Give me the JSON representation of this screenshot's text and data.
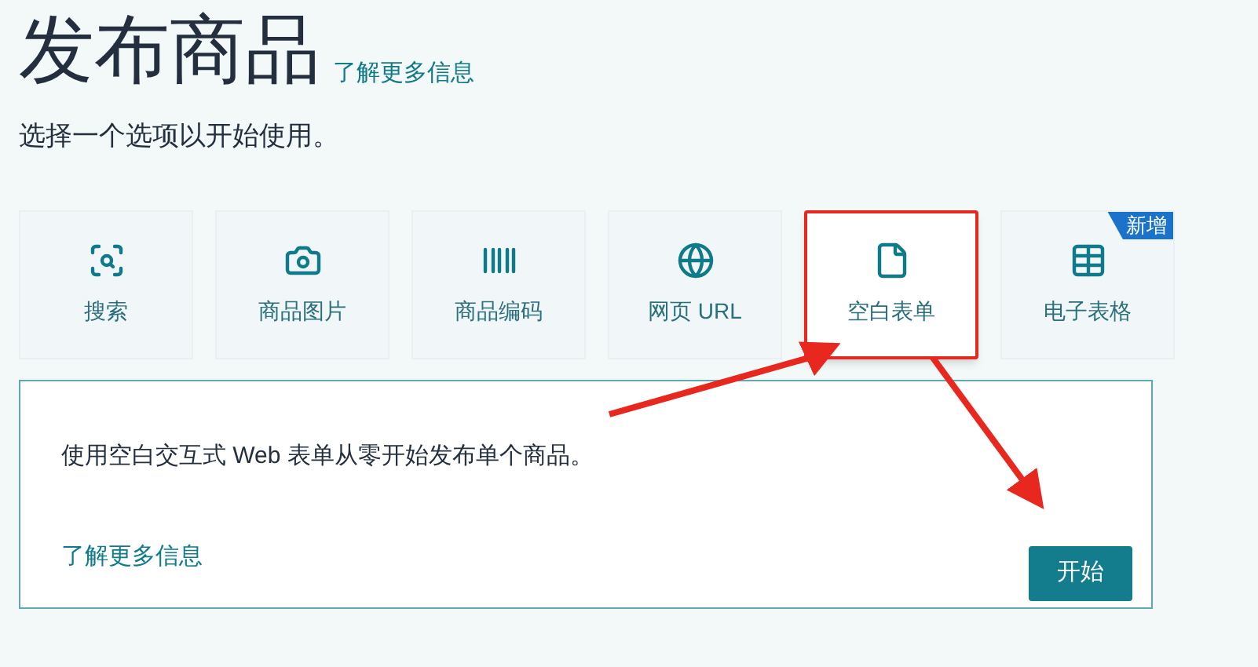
{
  "header": {
    "title": "发布商品",
    "link": "了解更多信息",
    "subtitle": "选择一个选项以开始使用。"
  },
  "options": [
    {
      "label": "搜索",
      "selected": false
    },
    {
      "label": "商品图片",
      "selected": false
    },
    {
      "label": "商品编码",
      "selected": false
    },
    {
      "label": "网页 URL",
      "selected": false
    },
    {
      "label": "空白表单",
      "selected": true
    },
    {
      "label": "电子表格",
      "selected": false,
      "badge": "新增"
    }
  ],
  "panel": {
    "description": "使用空白交互式 Web 表单从零开始发布单个商品。",
    "link": "了解更多信息",
    "button": "开始"
  }
}
